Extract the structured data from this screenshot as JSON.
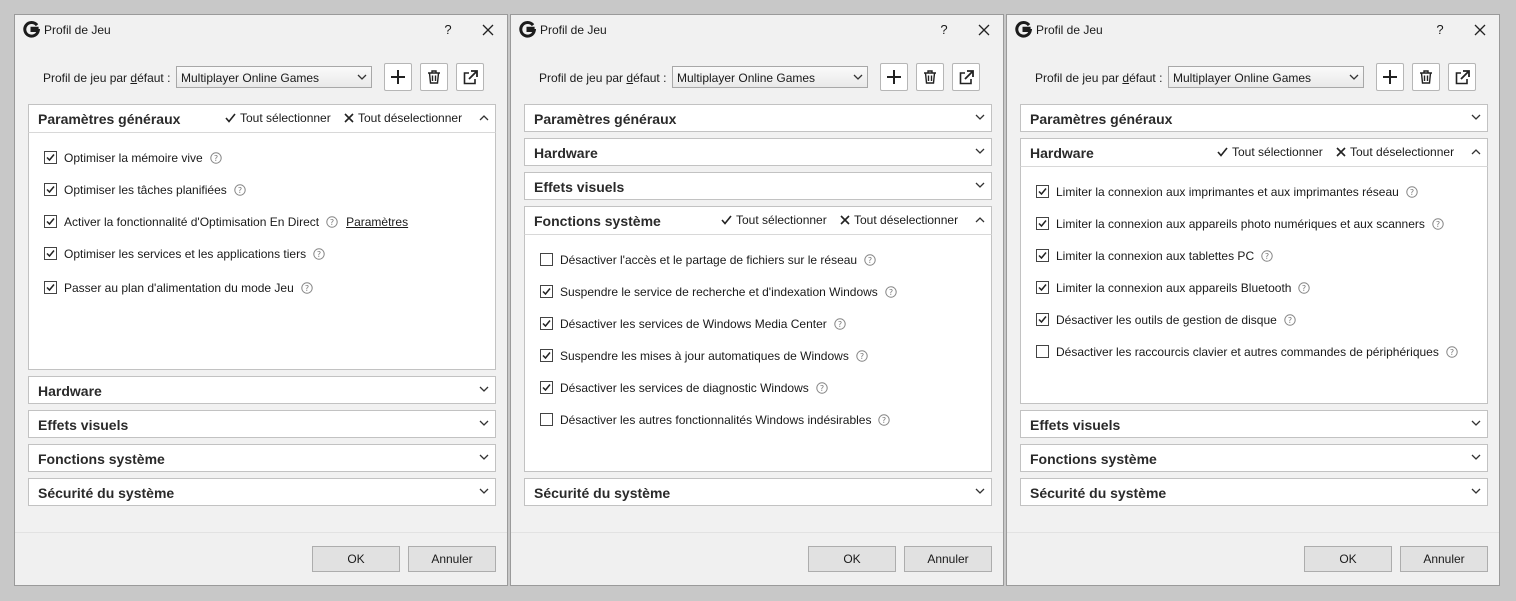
{
  "title": "Profil de Jeu",
  "help_glyph": "?",
  "profile_label_pre": "Profil de jeu par ",
  "profile_label_u": "d",
  "profile_label_post": "éfaut :",
  "profile_value": "Multiplayer Online Games",
  "select_all": "Tout sélectionner",
  "deselect_all": "Tout déselectionner",
  "ok_label": "OK",
  "cancel_label": "Annuler",
  "sections": {
    "general": "Paramètres généraux",
    "hardware": "Hardware",
    "visual": "Effets visuels",
    "system": "Fonctions système",
    "security": "Sécurité du système"
  },
  "general_items": [
    {
      "label": "Optimiser la mémoire vive",
      "checked": true
    },
    {
      "label": "Optimiser les tâches planifiées",
      "checked": true
    },
    {
      "label": "Activer la fonctionnalité d'Optimisation En Direct",
      "checked": true,
      "link": "Paramètres"
    },
    {
      "label": "Optimiser les services et les applications tiers",
      "checked": true
    },
    {
      "label": "Passer au plan d'alimentation du mode Jeu",
      "checked": true
    }
  ],
  "system_items": [
    {
      "label": "Désactiver l'accès et le partage de fichiers sur le réseau",
      "checked": false
    },
    {
      "label": "Suspendre le service de recherche et d'indexation Windows",
      "checked": true
    },
    {
      "label": "Désactiver les services de Windows Media Center",
      "checked": true
    },
    {
      "label": "Suspendre les mises à jour automatiques de Windows",
      "checked": true
    },
    {
      "label": "Désactiver les services de diagnostic Windows",
      "checked": true
    },
    {
      "label": "Désactiver les autres fonctionnalités Windows indésirables",
      "checked": false
    }
  ],
  "hardware_items": [
    {
      "label": "Limiter la connexion aux imprimantes et aux imprimantes réseau",
      "checked": true
    },
    {
      "label": "Limiter la connexion aux appareils photo numériques et aux scanners",
      "checked": true
    },
    {
      "label": "Limiter la connexion aux tablettes PC",
      "checked": true
    },
    {
      "label": "Limiter la connexion aux appareils Bluetooth",
      "checked": true
    },
    {
      "label": "Désactiver les outils de gestion de disque",
      "checked": true
    },
    {
      "label": "Désactiver les raccourcis clavier et autres commandes de périphériques",
      "checked": false
    }
  ]
}
